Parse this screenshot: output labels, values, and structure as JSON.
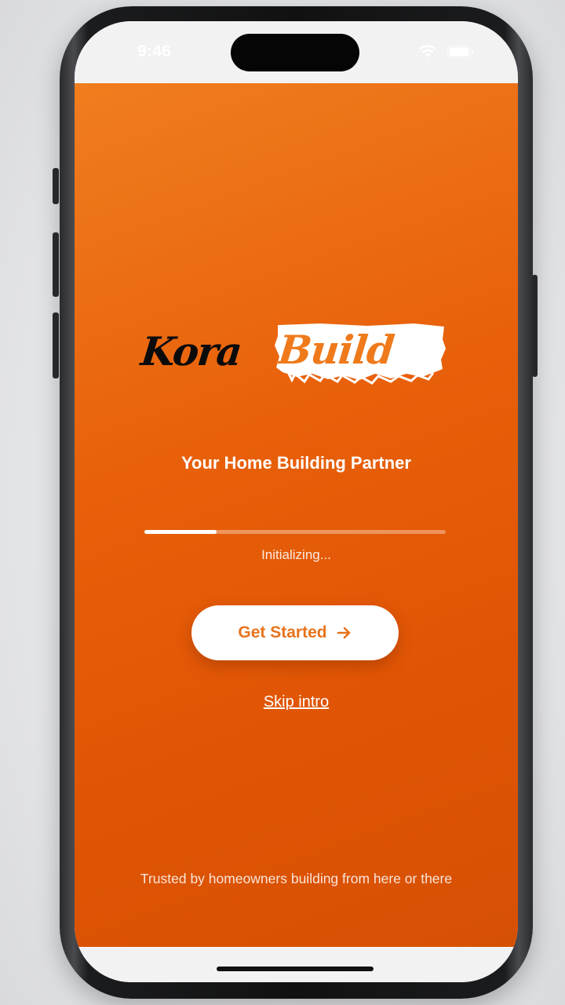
{
  "status_bar": {
    "time": "9:46",
    "icons": [
      "wifi-icon",
      "battery-icon"
    ]
  },
  "app": {
    "logo": {
      "part1": "Kora",
      "part2": "Build"
    },
    "tagline": "Your Home Building Partner",
    "progress": {
      "value": 0.24,
      "label": "Initializing..."
    },
    "cta": {
      "label": "Get Started",
      "icon": "arrow-right-icon"
    },
    "skip_label": "Skip intro",
    "footer": "Trusted by homeowners building from here or there"
  },
  "colors": {
    "brand_orange": "#e8600a",
    "accent_text": "#e8731c",
    "background_light": "#f2f2f3"
  }
}
